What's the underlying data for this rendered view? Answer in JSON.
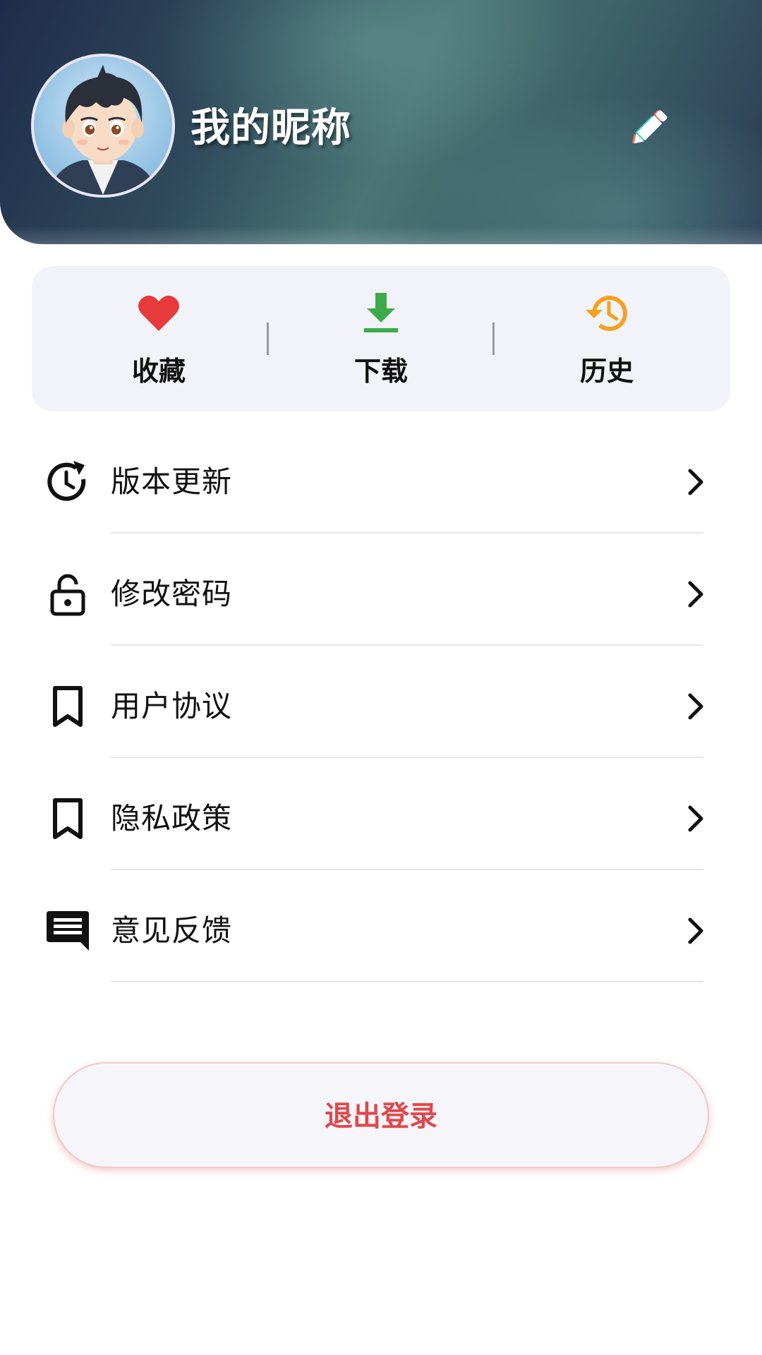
{
  "header": {
    "nickname": "我的昵称",
    "avatar_icon": "cartoon-boy-avatar",
    "edit_icon": "pencil-icon"
  },
  "quick_actions": [
    {
      "label": "收藏",
      "icon": "heart-icon",
      "color": "#e8393b"
    },
    {
      "label": "下载",
      "icon": "download-icon",
      "color": "#3cab4a"
    },
    {
      "label": "历史",
      "icon": "history-icon",
      "color": "#f4a020"
    }
  ],
  "menu": [
    {
      "label": "版本更新",
      "icon": "update-clock-icon"
    },
    {
      "label": "修改密码",
      "icon": "lock-icon"
    },
    {
      "label": "用户协议",
      "icon": "bookmark-icon"
    },
    {
      "label": "隐私政策",
      "icon": "bookmark-icon"
    },
    {
      "label": "意见反馈",
      "icon": "feedback-message-icon"
    }
  ],
  "logout": {
    "label": "退出登录",
    "color": "#e0484c"
  }
}
